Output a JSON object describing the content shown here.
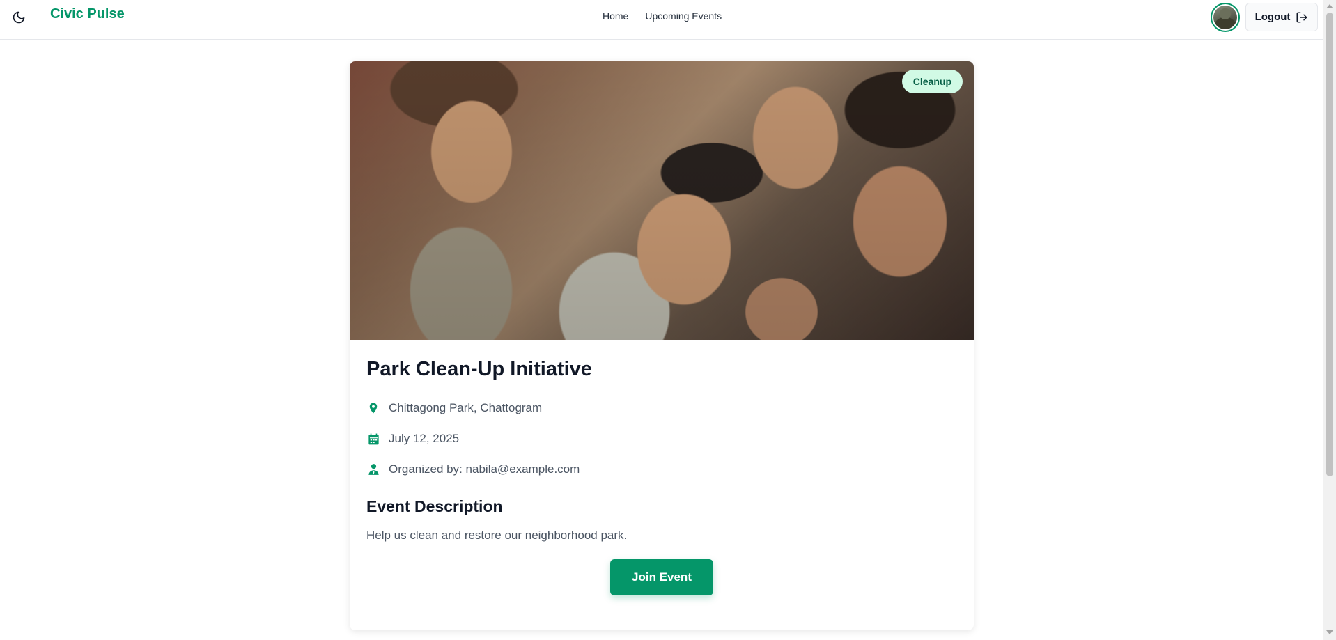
{
  "nav": {
    "brand": "Civic Pulse",
    "links": [
      "Home",
      "Upcoming Events"
    ],
    "logout_label": "Logout",
    "theme_icon": "moon-icon",
    "logout_icon": "logout-arrow-icon"
  },
  "event": {
    "category": "Cleanup",
    "title": "Park Clean-Up Initiative",
    "location": "Chittagong Park, Chattogram",
    "date": "July 12, 2025",
    "organizer": "Organized by: nabila@example.com",
    "description_heading": "Event Description",
    "description": "Help us clean and restore our neighborhood park.",
    "join_label": "Join Event",
    "image_subject": "group of smiling children"
  },
  "colors": {
    "accent": "#059669",
    "badge_bg": "#d1fae5",
    "badge_text": "#065f46"
  }
}
